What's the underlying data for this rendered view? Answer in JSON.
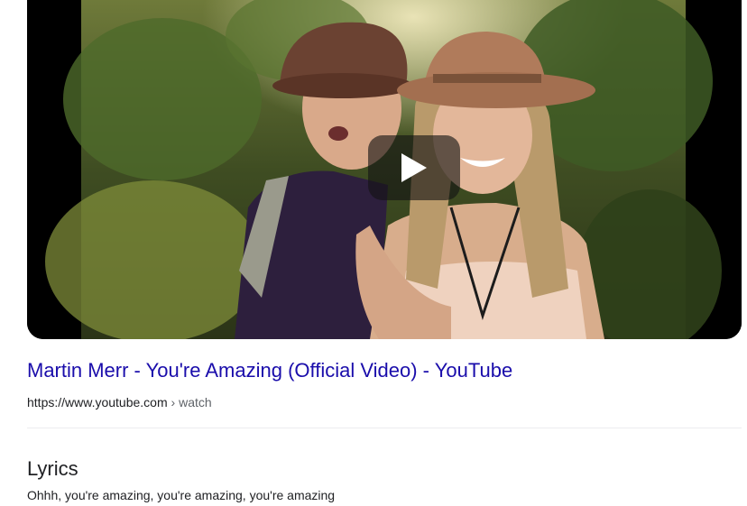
{
  "result": {
    "title": "Martin Merr - You're Amazing (Official Video) - YouTube",
    "url_host": "https://www.youtube.com",
    "url_separator": " › ",
    "url_path": "watch"
  },
  "video": {
    "play_icon": "play-icon"
  },
  "lyrics": {
    "heading": "Lyrics",
    "line": "Ohhh, you're amazing, you're amazing, you're amazing"
  },
  "colors": {
    "link": "#1a0dab",
    "text": "#202124",
    "muted": "#5f6368",
    "divider": "#ecedef"
  }
}
